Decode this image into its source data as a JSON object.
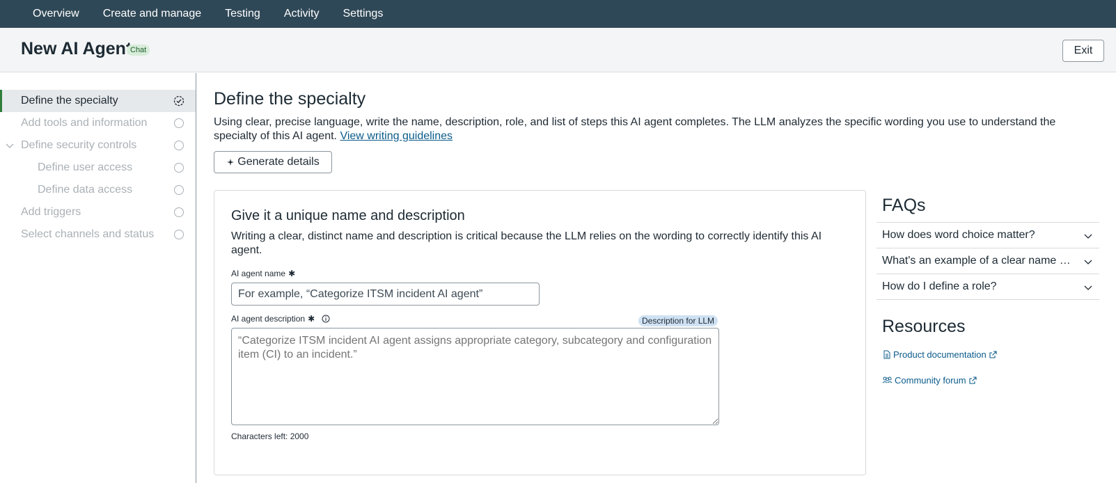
{
  "topnav": {
    "items": [
      "Overview",
      "Create and manage",
      "Testing",
      "Activity",
      "Settings"
    ]
  },
  "header": {
    "title": "New AI Agent",
    "badge": "Chat",
    "exit_label": "Exit"
  },
  "sidebar": {
    "steps": [
      {
        "label": "Define the specialty",
        "state": "active"
      },
      {
        "label": "Add tools and information",
        "state": "pending"
      },
      {
        "label": "Define security controls",
        "state": "pending",
        "expanded": true
      },
      {
        "label": "Define user access",
        "state": "pending",
        "sub": true
      },
      {
        "label": "Define data access",
        "state": "pending",
        "sub": true
      },
      {
        "label": "Add triggers",
        "state": "pending"
      },
      {
        "label": "Select channels and status",
        "state": "pending"
      }
    ]
  },
  "main": {
    "title": "Define the specialty",
    "intro": "Using clear, precise language, write the name, description, role, and list of steps this AI agent completes. The LLM analyzes the specific wording you use to understand the specialty of this AI agent.",
    "guidelines_link": "View writing guidelines",
    "generate_label": "Generate details",
    "card": {
      "title": "Give it a unique name and description",
      "description": "Writing a clear, distinct name and description is critical because the LLM relies on the wording to correctly identify this AI agent.",
      "name_label": "AI agent name",
      "name_placeholder": "For example, “Categorize ITSM incident AI agent”",
      "desc_label": "AI agent description",
      "llm_badge": "Description for LLM",
      "desc_placeholder": "“Categorize ITSM incident AI agent assigns appropriate category, subcategory and configuration item (CI) to an incident.”",
      "chars_left": "Characters left: 2000"
    }
  },
  "faqs": {
    "title": "FAQs",
    "items": [
      "How does word choice matter?",
      "What's an example of a clear name and description?",
      "How do I define a role?"
    ]
  },
  "resources": {
    "title": "Resources",
    "links": [
      "Product documentation",
      "Community forum"
    ]
  },
  "colors": {
    "nav_bg": "#2f4857",
    "accent_green": "#2f7d3b",
    "link": "#0b5b8a"
  }
}
